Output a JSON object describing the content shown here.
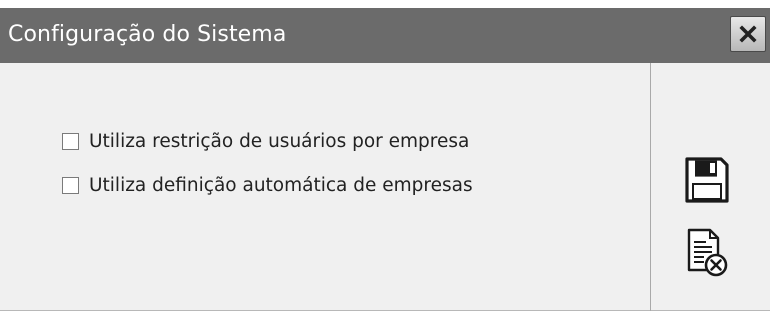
{
  "window": {
    "title": "Configuração do Sistema",
    "close_icon": "close-icon"
  },
  "options": [
    {
      "label": "Utiliza restrição de usuários por empresa",
      "checked": false
    },
    {
      "label": "Utiliza definição automática de empresas",
      "checked": false
    }
  ],
  "toolbar": {
    "save_icon": "floppy-disk-icon",
    "cancel_icon": "document-cancel-icon"
  },
  "colors": {
    "titlebar": "#6b6b6b",
    "panel": "#f0f0f0",
    "icon": "#1a1a1a"
  }
}
